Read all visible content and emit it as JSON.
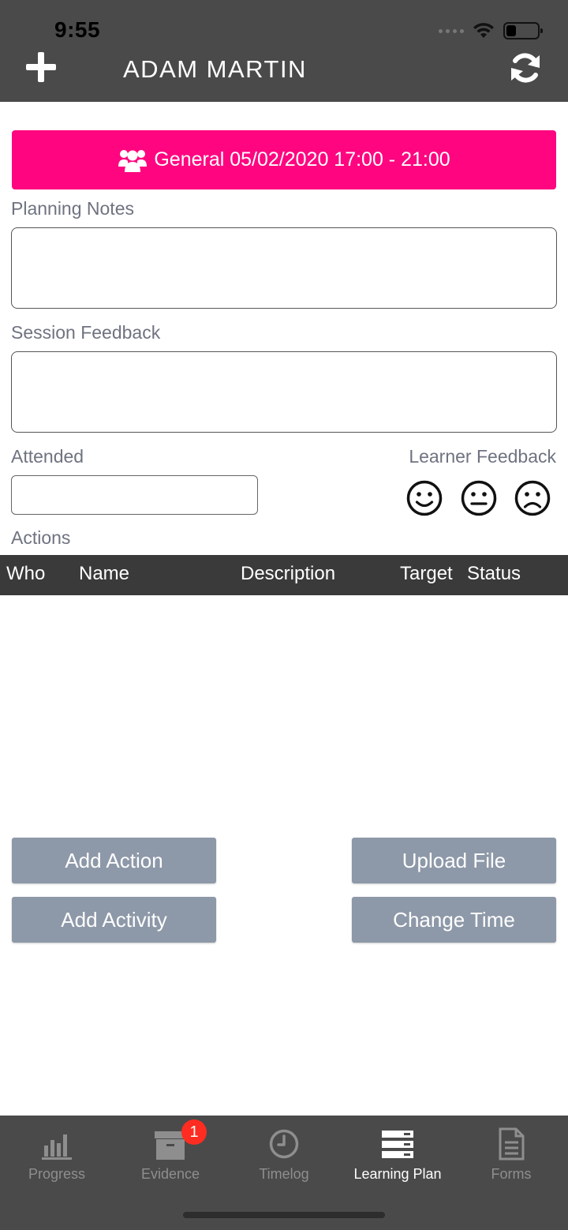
{
  "status_bar": {
    "time": "9:55"
  },
  "header": {
    "title": "ADAM MARTIN",
    "add_icon": "plus-icon",
    "refresh_icon": "refresh-icon"
  },
  "session": {
    "label": "General 05/02/2020 17:00 - 21:00",
    "icon": "users-icon",
    "color": "#ff0680"
  },
  "form": {
    "planning_notes_label": "Planning Notes",
    "planning_notes_value": "",
    "session_feedback_label": "Session Feedback",
    "session_feedback_value": "",
    "attended_label": "Attended",
    "attended_value": "",
    "learner_feedback_label": "Learner Feedback",
    "feedback_faces": [
      "smile-face-icon",
      "neutral-face-icon",
      "sad-face-icon"
    ]
  },
  "actions": {
    "label": "Actions",
    "columns": [
      "Who",
      "Name",
      "Description",
      "Target",
      "Status"
    ],
    "rows": []
  },
  "buttons": {
    "add_action": "Add Action",
    "upload_file": "Upload File",
    "add_activity": "Add Activity",
    "change_time": "Change Time"
  },
  "tabs": [
    {
      "label": "Progress",
      "icon": "bar-chart-icon",
      "active": false
    },
    {
      "label": "Evidence",
      "icon": "archive-box-icon",
      "active": false,
      "badge": "1"
    },
    {
      "label": "Timelog",
      "icon": "clock-icon",
      "active": false
    },
    {
      "label": "Learning Plan",
      "icon": "server-stack-icon",
      "active": true
    },
    {
      "label": "Forms",
      "icon": "document-icon",
      "active": false
    }
  ],
  "colors": {
    "header_bg": "#4a4a4a",
    "table_header_bg": "#3a3a3a",
    "button_bg": "#8d98a8",
    "badge_bg": "#ff2d21"
  }
}
